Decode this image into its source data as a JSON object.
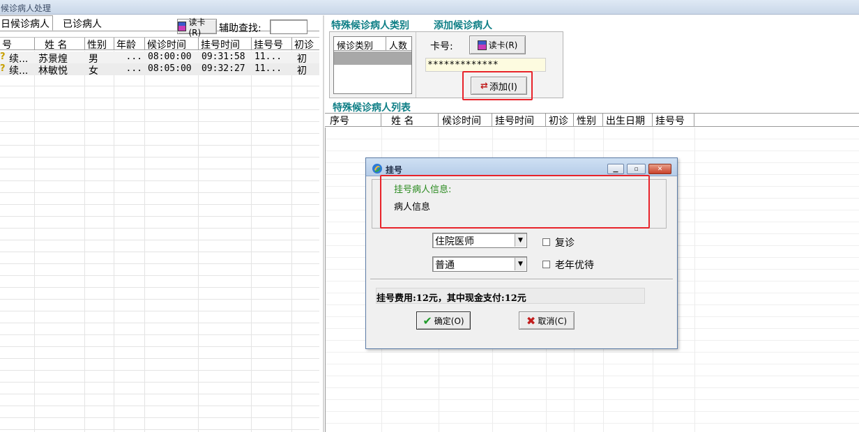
{
  "window": {
    "title": "候诊病人处理"
  },
  "tabs": [
    {
      "label": "日候诊病人",
      "active": true
    },
    {
      "label": "已诊病人",
      "active": false
    }
  ],
  "toolbar": {
    "read_card_label": "读卡(R)",
    "assist_search_label": "辅助查找:",
    "assist_search_value": ""
  },
  "waiting_table": {
    "columns": [
      "号",
      "姓 名",
      "性别",
      "年龄",
      "候诊时间",
      "挂号时间",
      "挂号号",
      "初诊"
    ],
    "rows": [
      {
        "no": "续...",
        "name": "苏景煌",
        "sex": "男",
        "age": "...",
        "wait_time": "08:00:00",
        "reg_time": "09:31:58",
        "reg_no": "11...",
        "first": "初"
      },
      {
        "no": "续...",
        "name": "林敏悦",
        "sex": "女",
        "age": "...",
        "wait_time": "08:05:00",
        "reg_time": "09:32:27",
        "reg_no": "11...",
        "first": "初"
      }
    ]
  },
  "special": {
    "category_title": "特殊候诊病人类别",
    "add_title": "添加候诊病人",
    "category_columns": [
      "候诊类别",
      "人数"
    ],
    "card_label": "卡号:",
    "read_card_label": "读卡(R)",
    "card_value": "*************",
    "add_button_label": "添加(I)",
    "list_title": "特殊候诊病人列表",
    "list_columns": [
      "序号",
      "姓 名",
      "候诊时间",
      "挂号时间",
      "初诊",
      "性别",
      "出生日期",
      "挂号号"
    ]
  },
  "dialog": {
    "title": "挂号",
    "info_heading": "挂号病人信息:",
    "info_text": "病人信息",
    "doctor_select": "住院医师",
    "type_select": "普通",
    "revisit_label": "复诊",
    "elderly_label": "老年优待",
    "fee_text": "挂号费用:12元，其中现金支付:12元",
    "ok_label": "确定(O)",
    "cancel_label": "取消(C)"
  },
  "colors": {
    "section_title": "#0f7f86",
    "highlight": "#e8232a",
    "info_heading": "#2a8a1f"
  }
}
